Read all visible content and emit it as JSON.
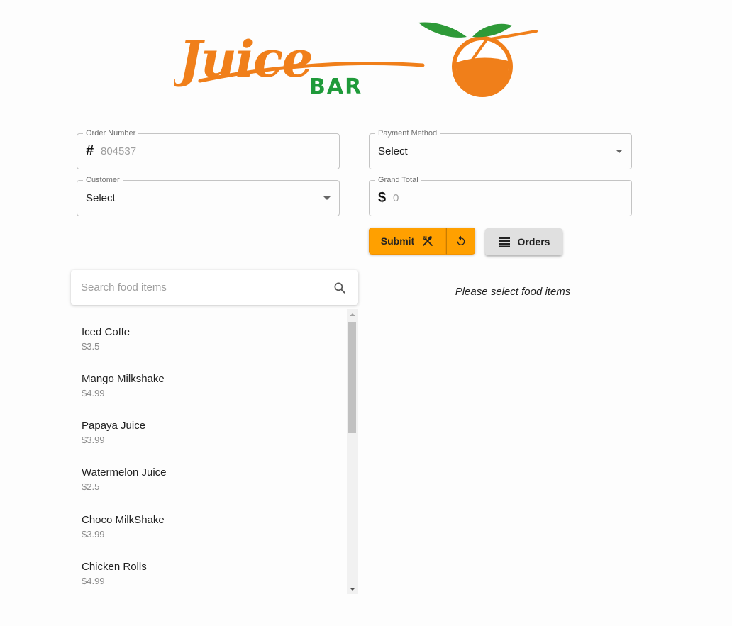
{
  "brand": {
    "logo_text": "Juice",
    "logo_subtext": "BAR",
    "colors": {
      "orange": "#f07f1a",
      "green": "#1f9a3a",
      "leaf": "#2e9a38"
    }
  },
  "form": {
    "order_number": {
      "label": "Order Number",
      "prefix": "#",
      "value": "804537"
    },
    "customer": {
      "label": "Customer",
      "value": "Select"
    },
    "payment_method": {
      "label": "Payment Method",
      "value": "Select"
    },
    "grand_total": {
      "label": "Grand Total",
      "prefix": "$",
      "value": "0"
    }
  },
  "buttons": {
    "submit_label": "Submit",
    "submit_icon": "restaurant-icon",
    "reset_icon": "reset-icon",
    "orders_label": "Orders",
    "orders_icon": "list-icon",
    "accent": "#ffa000"
  },
  "search": {
    "placeholder": "Search food items",
    "icon": "search-icon"
  },
  "food_items": [
    {
      "name": "Iced Coffe",
      "price": "$3.5"
    },
    {
      "name": "Mango Milkshake",
      "price": "$4.99"
    },
    {
      "name": "Papaya Juice",
      "price": "$3.99"
    },
    {
      "name": "Watermelon Juice",
      "price": "$2.5"
    },
    {
      "name": "Choco MilkShake",
      "price": "$3.99"
    },
    {
      "name": "Chicken Rolls",
      "price": "$4.99"
    }
  ],
  "order_panel": {
    "empty_message": "Please select food items"
  }
}
